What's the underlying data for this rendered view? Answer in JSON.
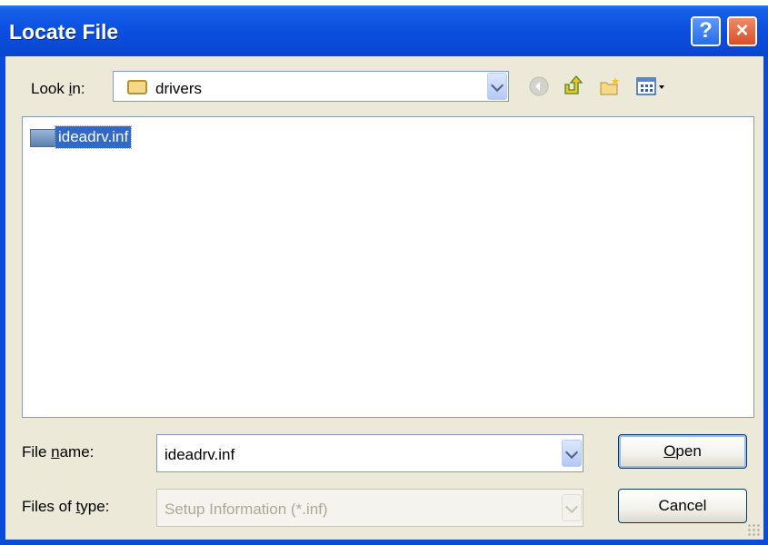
{
  "window": {
    "title": "Locate File",
    "help_label": "?",
    "close_label": "×"
  },
  "toolbar": {
    "lookin_label_pre": "Look ",
    "lookin_label_accel": "i",
    "lookin_label_post": "n:",
    "lookin_value": "drivers",
    "icons": [
      "back-icon",
      "up-folder-icon",
      "new-folder-icon",
      "views-menu-icon"
    ]
  },
  "files": [
    {
      "name": "ideadrv.inf",
      "selected": true,
      "icon": "inf-file-icon"
    }
  ],
  "filename": {
    "label_pre": "File ",
    "label_accel": "n",
    "label_post": "ame:",
    "value": "ideadrv.inf"
  },
  "filetype": {
    "label_pre": "Files of ",
    "label_accel": "t",
    "label_post": "ype:",
    "value": "Setup Information (*.inf)"
  },
  "buttons": {
    "open_accel": "O",
    "open_rest": "pen",
    "cancel": "Cancel"
  },
  "colors": {
    "titlebar": "#0b4fe0",
    "client": "#ece9d8",
    "selection": "#316ac5",
    "close_button": "#d8502a"
  }
}
